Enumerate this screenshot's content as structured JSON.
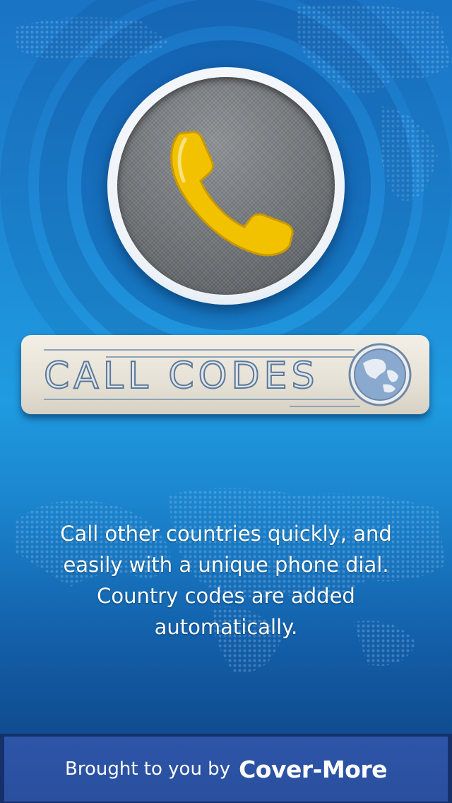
{
  "splash": {
    "app_name": "CALL CODES",
    "description_lines": [
      "Call other countries quickly, and",
      "easily with a unique phone dial.",
      "Country codes are added",
      "automatically."
    ]
  },
  "footer": {
    "prefix": "Brought to you by",
    "brand": "Cover-More"
  },
  "icons": {
    "logo": "phone-handset-icon",
    "banner": "globe-icon"
  },
  "colors": {
    "phone_yellow": "#f2c200",
    "footer_blue": "#2a4f9e",
    "background_blue": "#1f9be0"
  }
}
